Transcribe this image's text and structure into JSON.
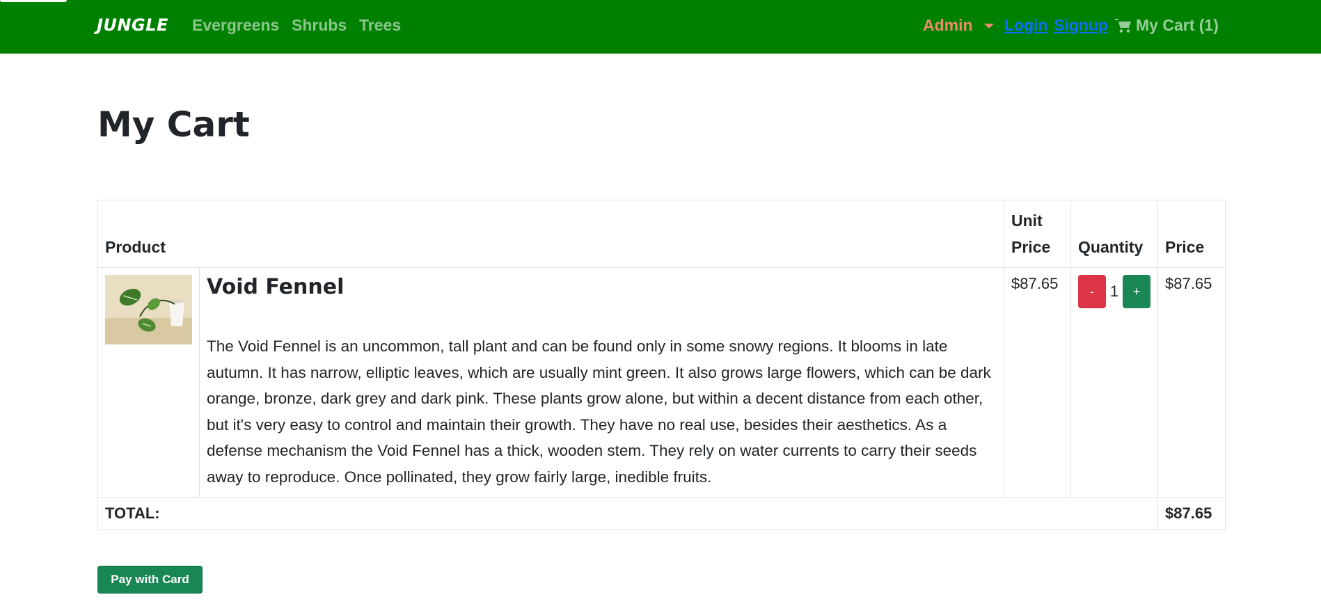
{
  "nav": {
    "brand": "JUNGLE",
    "links": [
      "Evergreens",
      "Shrubs",
      "Trees"
    ],
    "admin_label": "Admin",
    "login": "Login",
    "signup": "Signup",
    "cart_label": "My Cart (1)"
  },
  "page": {
    "title": "My Cart"
  },
  "table": {
    "headers": [
      "Product",
      "Unit Price",
      "Quantity",
      "Price"
    ],
    "rows": [
      {
        "name": "Void Fennel",
        "description": "The Void Fennel is an uncommon, tall plant and can be found only in some snowy regions. It blooms in late autumn. It has narrow, elliptic leaves, which are usually mint green. It also grows large flowers, which can be dark orange, bronze, dark grey and dark pink. These plants grow alone, but within a decent distance from each other, but it's very easy to control and maintain their growth. They have no real use, besides their aesthetics. As a defense mechanism the Void Fennel has a thick, wooden stem. They rely on water currents to carry their seeds away to reproduce. Once pollinated, they grow fairly large, inedible fruits.",
        "unit_price": "$87.65",
        "quantity": "1",
        "minus_label": "-",
        "plus_label": "+",
        "price": "$87.65"
      }
    ],
    "total_label": "TOTAL:",
    "total_value": "$87.65"
  },
  "actions": {
    "pay_label": "Pay with Card"
  },
  "colors": {
    "navbar": "#008000",
    "admin": "#f08a6e",
    "link": "#0d6efd",
    "danger": "#dc3545",
    "success": "#198754"
  }
}
